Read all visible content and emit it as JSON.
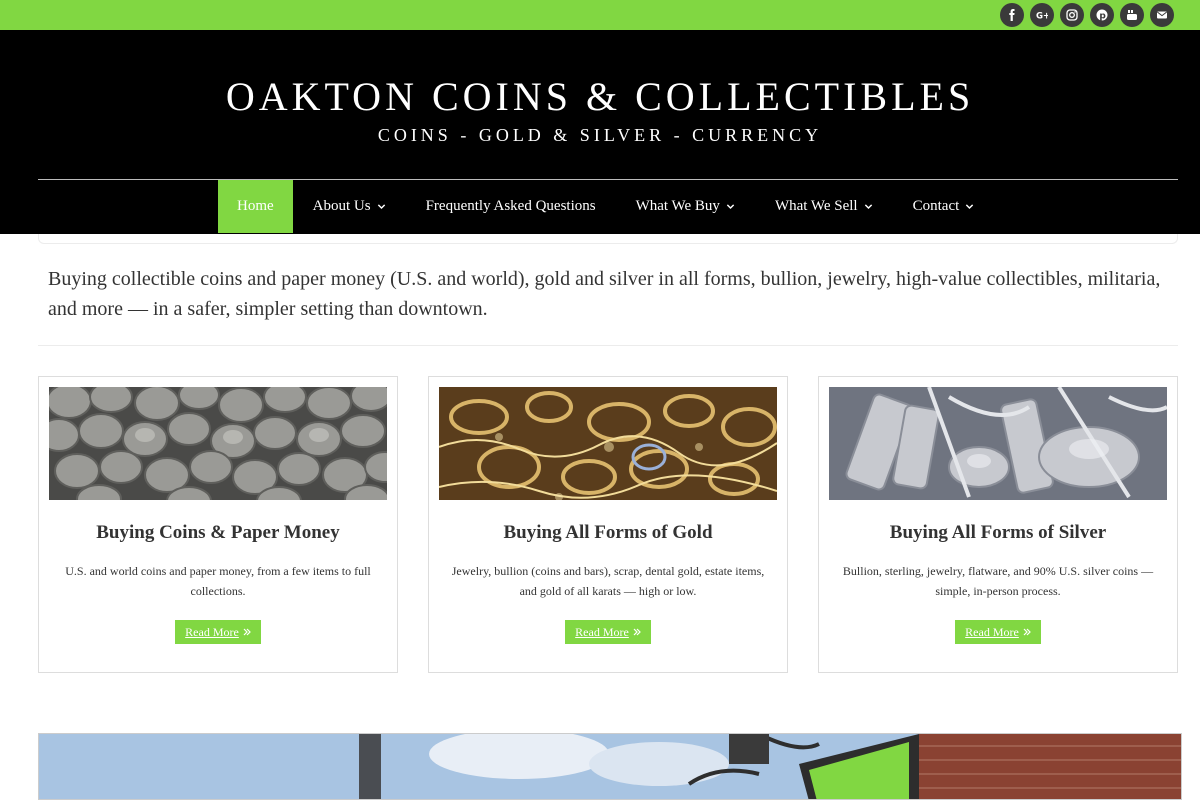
{
  "social": {
    "icons": [
      "facebook-icon",
      "google-plus-icon",
      "instagram-icon",
      "pinterest-icon",
      "youtube-icon",
      "envelope-icon"
    ]
  },
  "header": {
    "title": "OAKTON COINS & COLLECTIBLES",
    "tagline": "COINS - GOLD & SILVER - CURRENCY"
  },
  "nav": {
    "items": [
      {
        "label": "Home",
        "active": true
      },
      {
        "label": "About Us",
        "dropdown": true
      },
      {
        "label": "Frequently Asked Questions"
      },
      {
        "label": "What We Buy",
        "dropdown": true
      },
      {
        "label": "What We Sell",
        "dropdown": true
      },
      {
        "label": "Contact",
        "dropdown": true
      }
    ]
  },
  "intro": {
    "text": "Buying collectible coins and paper money (U.S. and world), gold and silver in all forms, bullion, jewelry, high-value collectibles, militaria, and more — in a safer, simpler setting than downtown."
  },
  "cards": [
    {
      "title": "Buying Coins & Paper Money",
      "text": "U.S. and world coins and paper money, from a few items to full collections.",
      "button": "Read More"
    },
    {
      "title": "Buying All Forms of Gold",
      "text": "Jewelry, bullion (coins and bars), scrap, dental gold, estate items, and gold of all karats — high or low.",
      "button": "Read More"
    },
    {
      "title": "Buying All Forms of Silver",
      "text": "Bullion, sterling, jewelry, flatware, and 90% U.S. silver coins — simple, in-person process.",
      "button": "Read More"
    }
  ],
  "colors": {
    "accent": "#81d742",
    "header_bg": "#000000"
  }
}
